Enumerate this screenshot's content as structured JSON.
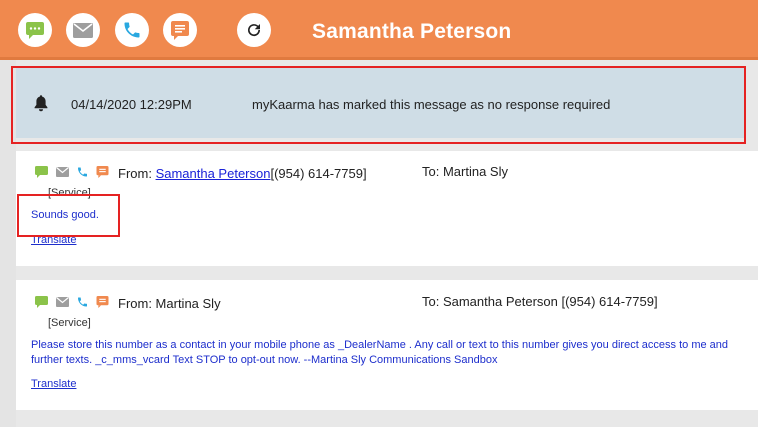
{
  "header": {
    "title": "Samantha Peterson",
    "buttons": [
      {
        "icon": "chat-icon",
        "color": "#8bc34a"
      },
      {
        "icon": "mail-icon",
        "color": "#9e9e9e"
      },
      {
        "icon": "phone-icon",
        "color": "#29a8e0"
      },
      {
        "icon": "note-icon",
        "color": "#f0894e"
      },
      {
        "icon": "refresh-icon",
        "color": "#222222"
      }
    ],
    "background": "#f0894e"
  },
  "notice": {
    "icon": "bell-icon",
    "date": "04/14/2020 12:29PM",
    "text": "myKaarma has marked this message as no response required"
  },
  "messages": [
    {
      "from_label": "From: ",
      "from_name": "Samantha Peterson",
      "from_phone": "[(954) 614-7759]",
      "to": "To: Martina Sly",
      "service": "[Service]",
      "body": "Sounds good.",
      "translate": "Translate"
    },
    {
      "from_label": "From: Martina Sly",
      "to": "To: Samantha Peterson [(954) 614-7759]",
      "service": "[Service]",
      "body_line1": "Please store this number as a contact in your mobile phone as _DealerName . Any call or text to this number gives you direct access to me and",
      "body_line2": "further texts. _c_mms_vcard Text STOP to opt-out now. --Martina Sly Communications Sandbox",
      "translate": "Translate"
    }
  ],
  "colors": {
    "link": "#1a22d8",
    "highlight": "#e52222",
    "notice_bg": "#cfdde6"
  }
}
